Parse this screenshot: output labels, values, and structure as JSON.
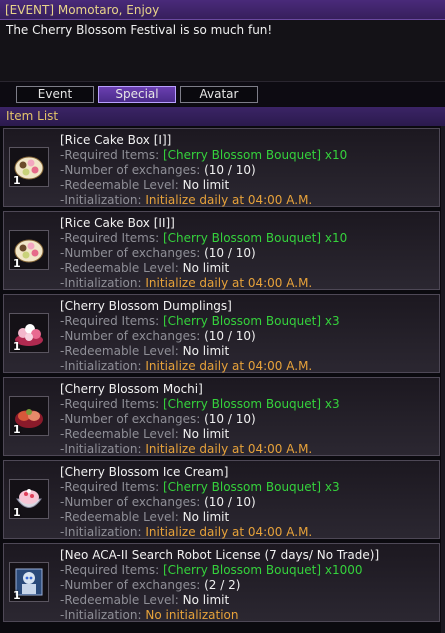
{
  "window": {
    "title": "[EVENT] Momotaro, Enjoy"
  },
  "message": "The Cherry Blossom Festival is so much fun!",
  "tabs": [
    {
      "label": "Event",
      "active": false
    },
    {
      "label": "Special",
      "active": true
    },
    {
      "label": "Avatar",
      "active": false
    }
  ],
  "section": {
    "title": "Item List"
  },
  "labels": {
    "required": "-Required Items:",
    "exchanges": "-Number of exchanges:",
    "level": "-Redeemable Level:",
    "init": "-Initialization:"
  },
  "items": [
    {
      "name": "[Rice Cake Box [I]]",
      "required": "[Cherry Blossom Bouquet] x10",
      "exchanges": "(10 / 10)",
      "level": "No limit",
      "init": "Initialize daily at 04:00 A.M.",
      "qty": "1",
      "icon": "rice-cake-box-icon"
    },
    {
      "name": "[Rice Cake Box [II]]",
      "required": "[Cherry Blossom Bouquet] x10",
      "exchanges": "(10 / 10)",
      "level": "No limit",
      "init": "Initialize daily at 04:00 A.M.",
      "qty": "1",
      "icon": "rice-cake-box-icon"
    },
    {
      "name": "[Cherry Blossom Dumplings]",
      "required": "[Cherry Blossom Bouquet] x3",
      "exchanges": "(10 / 10)",
      "level": "No limit",
      "init": "Initialize daily at 04:00 A.M.",
      "qty": "1",
      "icon": "dumplings-icon"
    },
    {
      "name": "[Cherry Blossom Mochi]",
      "required": "[Cherry Blossom Bouquet] x3",
      "exchanges": "(10 / 10)",
      "level": "No limit",
      "init": "Initialize daily at 04:00 A.M.",
      "qty": "1",
      "icon": "mochi-icon"
    },
    {
      "name": "[Cherry Blossom Ice Cream]",
      "required": "[Cherry Blossom Bouquet] x3",
      "exchanges": "(10 / 10)",
      "level": "No limit",
      "init": "Initialize daily at 04:00 A.M.",
      "qty": "1",
      "icon": "ice-cream-icon"
    },
    {
      "name": "[Neo ACA-II Search Robot License (7 days/ No Trade)]",
      "required": "[Cherry Blossom Bouquet] x1000",
      "exchanges": "(2 / 2)",
      "level": "No limit",
      "init": "No initialization",
      "qty": "1",
      "icon": "robot-license-icon"
    }
  ]
}
